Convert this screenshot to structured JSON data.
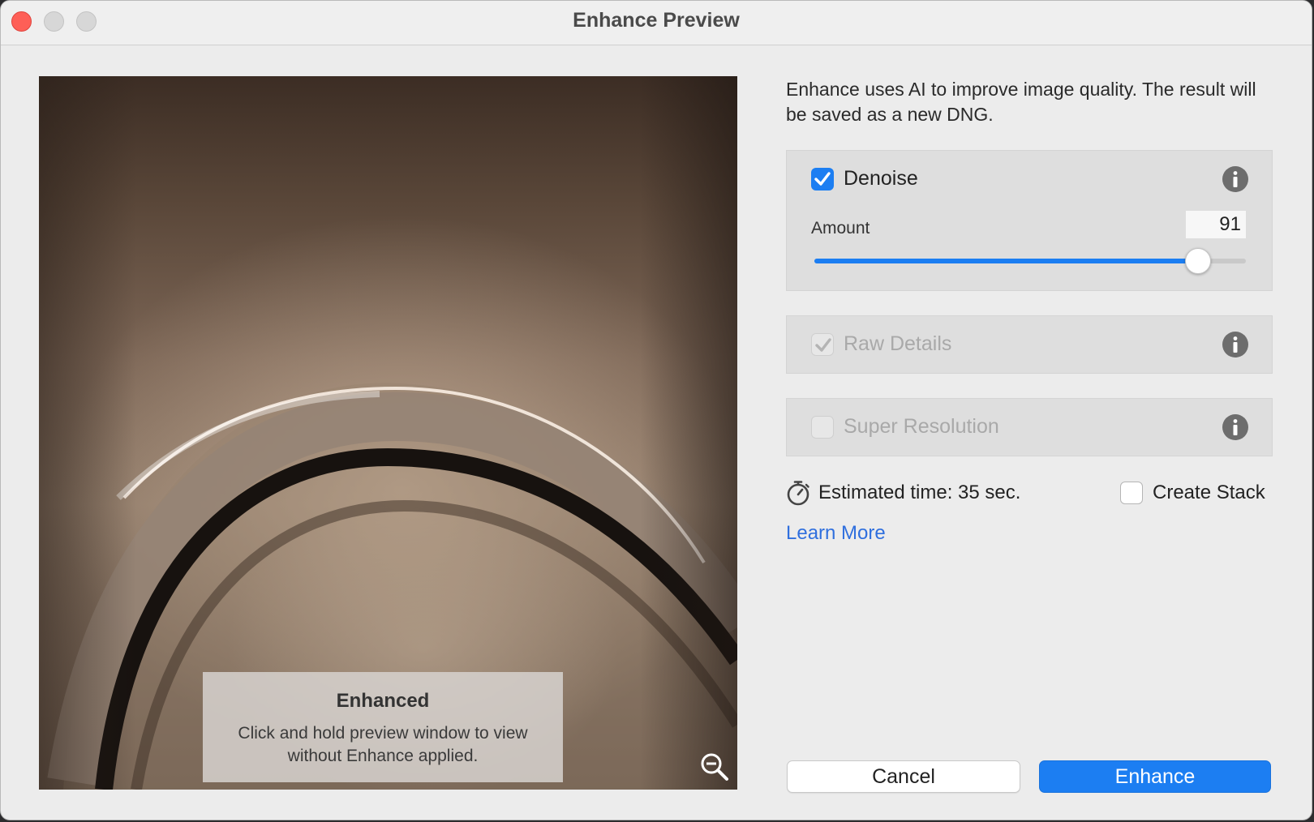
{
  "window": {
    "title": "Enhance Preview"
  },
  "preview": {
    "overlay_title": "Enhanced",
    "overlay_text": "Click and hold preview window to view without Enhance applied.",
    "zoom_icon": "zoom-out-icon"
  },
  "description": "Enhance uses AI to improve image quality. The result will be saved as a new DNG.",
  "options": {
    "denoise": {
      "label": "Denoise",
      "checked": true,
      "enabled": true,
      "amount_label": "Amount",
      "amount_value": "91",
      "slider_fraction": 0.89
    },
    "raw_details": {
      "label": "Raw Details",
      "checked": true,
      "enabled": false
    },
    "super_resolution": {
      "label": "Super Resolution",
      "checked": false,
      "enabled": false
    }
  },
  "estimate": {
    "text": "Estimated time: 35 sec.",
    "icon": "stopwatch-icon"
  },
  "create_stack": {
    "label": "Create Stack",
    "checked": false
  },
  "learn_more": "Learn More",
  "buttons": {
    "cancel": "Cancel",
    "enhance": "Enhance"
  },
  "colors": {
    "accent": "#1c7ef2",
    "link": "#2f6fde",
    "close": "#fe5f57"
  }
}
